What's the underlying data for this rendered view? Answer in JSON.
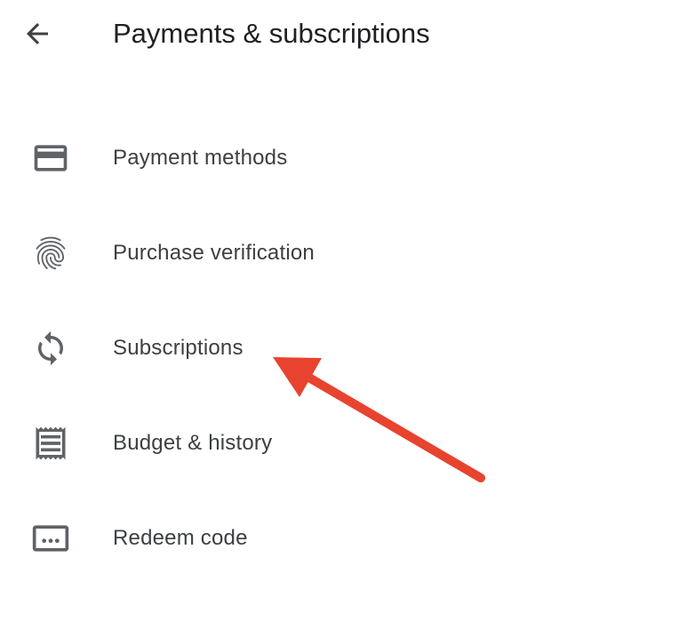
{
  "header": {
    "title": "Payments & subscriptions",
    "back_icon": "arrow-back-icon"
  },
  "menu": {
    "items": [
      {
        "label": "Payment methods",
        "icon": "credit-card-icon"
      },
      {
        "label": "Purchase verification",
        "icon": "fingerprint-icon"
      },
      {
        "label": "Subscriptions",
        "icon": "sync-icon"
      },
      {
        "label": "Budget & history",
        "icon": "receipt-icon"
      },
      {
        "label": "Redeem code",
        "icon": "redeem-code-icon"
      }
    ]
  },
  "colors": {
    "text_primary": "#202124",
    "text_secondary": "#3c4043",
    "icon": "#5f6368",
    "annotation_arrow": "#e8432f"
  }
}
